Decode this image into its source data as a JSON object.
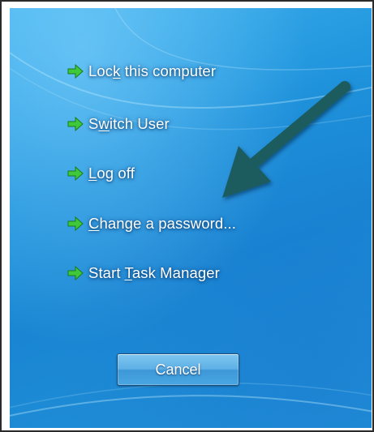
{
  "menu": {
    "items": [
      {
        "pre": "Loc",
        "key": "k",
        "post": " this computer",
        "icon": "green-arrow-icon"
      },
      {
        "pre": "S",
        "key": "w",
        "post": "itch User",
        "icon": "green-arrow-icon"
      },
      {
        "pre": "",
        "key": "L",
        "post": "og off",
        "icon": "green-arrow-icon"
      },
      {
        "pre": "",
        "key": "C",
        "post": "hange a password...",
        "icon": "green-arrow-icon"
      },
      {
        "pre": "Start ",
        "key": "T",
        "post": "ask Manager",
        "icon": "green-arrow-icon"
      }
    ]
  },
  "cancel_button": {
    "label": "Cancel"
  },
  "colors": {
    "arrow_green": "#3fc93a",
    "annotation_arrow": "#1e5c5f",
    "background_blue": "#1f93dc"
  }
}
